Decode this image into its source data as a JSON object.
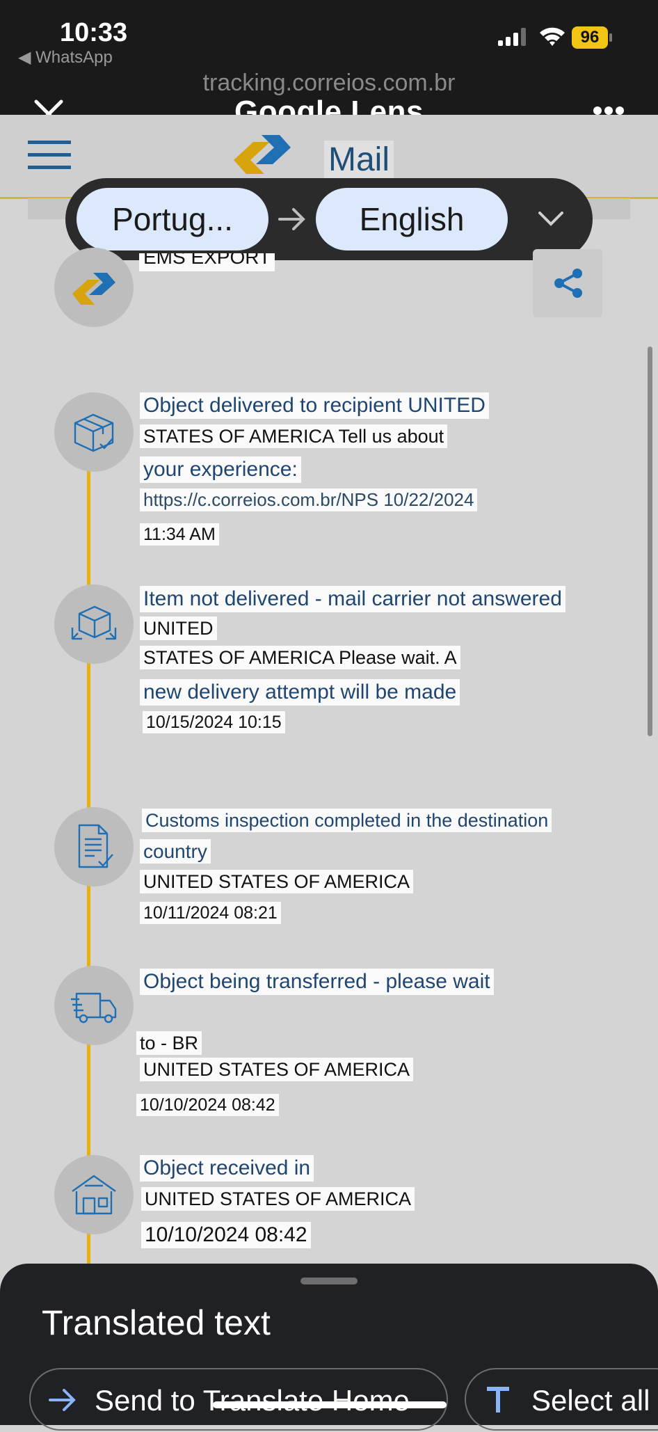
{
  "status_bar": {
    "time": "10:33",
    "back_app": "◀ WhatsApp",
    "battery": "96"
  },
  "lens": {
    "url": "tracking.correios.com.br",
    "title": "Google Lens",
    "source_language": "Portug...",
    "target_language": "English"
  },
  "site_header": {
    "title": "Mail"
  },
  "cut_off_label": "EMS EXPORT",
  "events": [
    {
      "icon": "package-delivered-icon",
      "lines": [
        "Object delivered to recipient UNITED",
        "STATES OF AMERICA Tell us about",
        "your experience:",
        "https://c.correios.com.br/NPS 10/22/2024",
        "11:34 AM"
      ]
    },
    {
      "icon": "package-return-icon",
      "lines": [
        "Item not delivered - mail carrier not answered",
        "UNITED",
        "STATES OF AMERICA Please wait. A",
        "new delivery attempt will be made",
        "10/15/2024 10:15"
      ]
    },
    {
      "icon": "document-check-icon",
      "lines": [
        "Customs inspection completed in the destination",
        "country",
        "UNITED STATES OF AMERICA",
        "10/11/2024 08:21"
      ]
    },
    {
      "icon": "delivery-truck-icon",
      "lines": [
        "Object being transferred - please wait",
        "to - BR",
        "UNITED STATES OF AMERICA",
        "10/10/2024 08:42"
      ]
    },
    {
      "icon": "warehouse-icon",
      "lines": [
        "Object received in",
        "UNITED STATES OF AMERICA",
        "10/10/2024 08:42"
      ]
    }
  ],
  "bottom_sheet": {
    "title": "Translated text",
    "send_button": "Send to Translate Home",
    "select_all_button": "Select all"
  },
  "colors": {
    "accent_yellow": "#e7b20d",
    "brand_blue": "#1f6fb5",
    "heading_blue": "#1f4670",
    "pill_blue": "#dce8fb",
    "sheet_bg": "#202124"
  }
}
